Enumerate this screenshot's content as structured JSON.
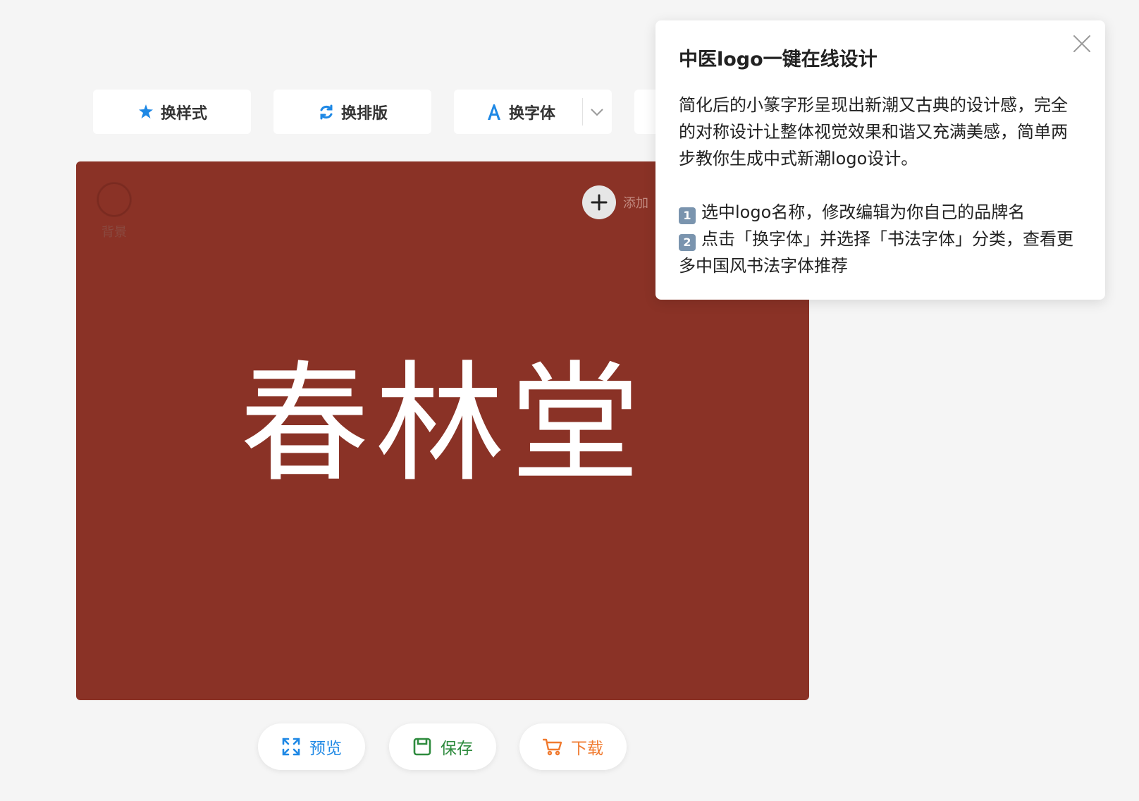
{
  "toolbar": {
    "style_label": "换样式",
    "layout_label": "换排版",
    "font_label": "换字体",
    "font_icon_glyph": "A"
  },
  "canvas": {
    "background_color": "#8a3226",
    "bg_label": "背景",
    "add_label": "添加",
    "logo_text": "春林堂"
  },
  "actions": {
    "preview_label": "预览",
    "save_label": "保存",
    "download_label": "下载"
  },
  "popover": {
    "title": "中医logo一键在线设计",
    "description": "简化后的小篆字形呈现出新潮又古典的设计感，完全的对称设计让整体视觉效果和谐又充满美感，简单两步教你生成中式新潮logo设计。",
    "steps": [
      {
        "badge": "1",
        "text": "选中logo名称，修改编辑为你自己的品牌名"
      },
      {
        "badge": "2",
        "text": "点击「换字体」并选择「书法字体」分类，查看更多中国风书法字体推荐"
      }
    ]
  },
  "colors": {
    "accent_blue": "#1e88e5",
    "save_green": "#2e8b3e",
    "download_orange": "#f07a2f",
    "canvas_red": "#8a3226"
  },
  "icons": {
    "style": "sparkle-icon",
    "layout": "refresh-icon",
    "font": "letter-a-icon",
    "font_dropdown": "chevron-down-icon",
    "add": "plus-icon",
    "preview": "expand-icon",
    "save": "save-icon",
    "download": "cart-icon",
    "close": "close-icon"
  }
}
